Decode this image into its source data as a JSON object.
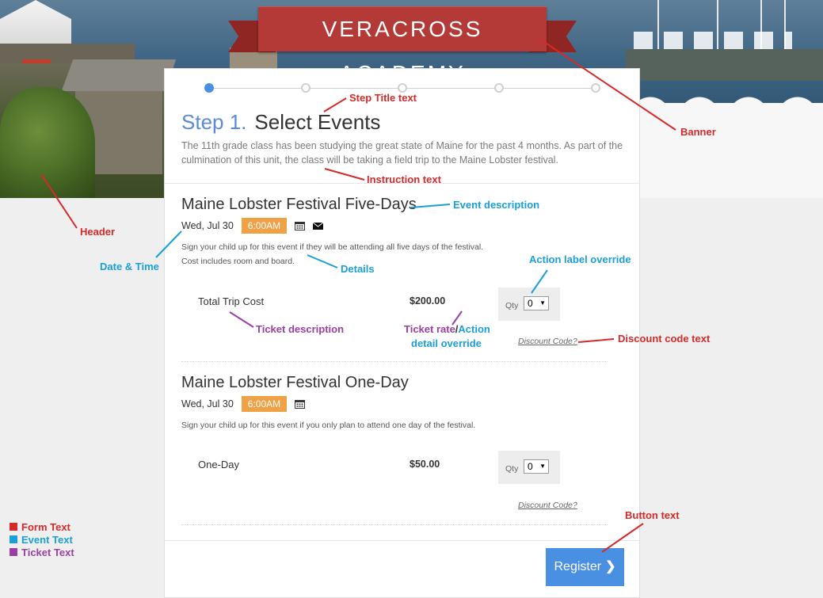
{
  "banner": {
    "title": "VERACROSS ACADEMY"
  },
  "stepper": {
    "steps": 5,
    "active_step": 1
  },
  "step": {
    "number": "Step 1.",
    "title": "Select Events",
    "instructions": "The 11th grade class has been studying the great state of Maine for the past 4 months. As part of the culmination of this unit, the class will be taking a field trip to the Maine Lobster festival."
  },
  "events": [
    {
      "title": "Maine Lobster Festival Five-Days",
      "date": "Wed, Jul 30",
      "time": "6:00AM",
      "details_line1": "Sign your child up for this event if they will be attending all five days of the festival.",
      "details_line2": "Cost includes room and board.",
      "ticket": {
        "description": "Total Trip Cost",
        "rate": "$200.00",
        "qty_label": "Qty",
        "qty_value": "0"
      },
      "discount": "Discount Code?"
    },
    {
      "title": "Maine Lobster Festival One-Day",
      "date": "Wed, Jul 30",
      "time": "6:00AM",
      "details_line1": "Sign your child up for this event if you only plan to attend one day of the festival.",
      "ticket": {
        "description": "One-Day",
        "rate": "$50.00",
        "qty_label": "Qty",
        "qty_value": "0"
      },
      "discount": "Discount Code?"
    }
  ],
  "register": {
    "label": "Register"
  },
  "annotations": {
    "step_title": "Step Title text",
    "banner": "Banner",
    "instruction": "Instruction text",
    "header": "Header",
    "event_description": "Event description",
    "date_time": "Date & Time",
    "details": "Details",
    "action_label_override": "Action label override",
    "ticket_description": "Ticket description",
    "ticket_rate": "Ticket rate",
    "slash": "/",
    "action": "Action",
    "detail_override": "detail override",
    "discount_code_text": "Discount code text",
    "button_text": "Button text"
  },
  "legend": [
    {
      "label": "Form Text",
      "color": "#d42a2a"
    },
    {
      "label": "Event Text",
      "color": "#1a9fd8"
    },
    {
      "label": "Ticket Text",
      "color": "#9b3fa4"
    }
  ],
  "colors": {
    "banner_red": "#b33a37",
    "accent_blue": "#4a90e2",
    "time_badge": "#f0a045",
    "annotation_red": "#d42a2a",
    "annotation_blue": "#1a9fd8",
    "annotation_purple": "#9b3fa4"
  }
}
